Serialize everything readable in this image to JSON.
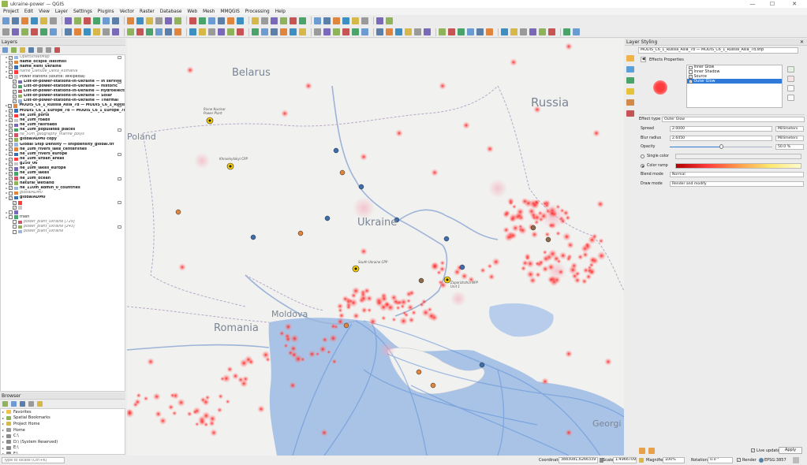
{
  "window": {
    "title": "ukraine-power — QGIS",
    "minimize": "—",
    "maximize": "☐",
    "close": "✕"
  },
  "menu": [
    "Project",
    "Edit",
    "View",
    "Layer",
    "Settings",
    "Plugins",
    "Vector",
    "Raster",
    "Database",
    "Web",
    "Mesh",
    "MMQGIS",
    "Processing",
    "Help"
  ],
  "colors": {
    "accent": "#2f7ad6",
    "heat": "#ff2020",
    "sea": "#a8c3e6",
    "shipping": "#5f8fd6"
  },
  "layers_panel": {
    "title": "Layers",
    "items": [
      {
        "label": "OpenStreetMap",
        "style": "ital",
        "indent": 1,
        "checked": true
      },
      {
        "label": "name_ocsple_lselimsli",
        "style": "bold",
        "indent": 1,
        "checked": true
      },
      {
        "label": "name_Reni_Ukraine",
        "style": "bold",
        "indent": 1,
        "checked": true
      },
      {
        "label": "name_Danube_Delta_Romania",
        "style": "ital",
        "indent": 1,
        "checked": false
      },
      {
        "label": "Power stations (source: Wikipedia)",
        "style": "normal",
        "indent": 1,
        "checked": true
      },
      {
        "label": "List-of-power-stations-in-Ukraine — In service",
        "style": "bold",
        "indent": 2,
        "checked": true
      },
      {
        "label": "List-of-power-stations-in-Ukraine — Historic",
        "style": "bold",
        "indent": 2,
        "checked": true
      },
      {
        "label": "List-of-power-stations-in-Ukraine — Hydroelectric",
        "style": "bold",
        "indent": 2,
        "checked": true
      },
      {
        "label": "List-of-power-stations-in-Ukraine — Solar",
        "style": "bold",
        "indent": 2,
        "checked": true
      },
      {
        "label": "List-of-power-stations-in-Ukraine — Thermal",
        "style": "bold",
        "indent": 2,
        "checked": true
      },
      {
        "label": "MODIS_C6_1_Russia_Asia_7d — MODIS_C6_1_Russia_Asia",
        "style": "bold",
        "indent": 1,
        "checked": true
      },
      {
        "label": "MODIS_C6_1_Europe_7d — MODIS_C6_1_Europe_7d.s",
        "style": "bold",
        "indent": 1,
        "checked": true
      },
      {
        "label": "ne_10m_ports",
        "style": "bold",
        "indent": 1,
        "checked": true
      },
      {
        "label": "ne_10m_roads",
        "style": "bold",
        "indent": 1,
        "checked": true
      },
      {
        "label": "ne_10m_railroads",
        "style": "bold",
        "indent": 1,
        "checked": true
      },
      {
        "label": "ne_10m_populated_places",
        "style": "bold",
        "indent": 1,
        "checked": true
      },
      {
        "label": "ne_50m_geography_marine_polys",
        "style": "ital",
        "indent": 1,
        "checked": false
      },
      {
        "label": "globalADM0 copy",
        "style": "bold",
        "indent": 1,
        "checked": true
      },
      {
        "label": "Global Ship Density — shipdensity_global.tif",
        "style": "bold",
        "indent": 1,
        "checked": true
      },
      {
        "label": "ne_10m_rivers_lake_centerlines",
        "style": "bold",
        "indent": 1,
        "checked": true
      },
      {
        "label": "ne_10m_rivers_europe",
        "style": "bold",
        "indent": 1,
        "checked": true
      },
      {
        "label": "ne_10m_urban_areas",
        "style": "bold",
        "indent": 1,
        "checked": true
      },
      {
        "label": "g250_06",
        "style": "bold",
        "indent": 1,
        "checked": true
      },
      {
        "label": "ne_10m_lakes_europe",
        "style": "bold",
        "indent": 1,
        "checked": true
      },
      {
        "label": "ne_10m_lakes",
        "style": "bold",
        "indent": 1,
        "checked": true
      },
      {
        "label": "ne_10m_ocean",
        "style": "bold",
        "indent": 1,
        "checked": true
      },
      {
        "label": "natural_wetland",
        "style": "bold",
        "indent": 1,
        "checked": true
      },
      {
        "label": "ne_110m_admin_0_countries",
        "style": "bold",
        "indent": 1,
        "checked": true
      },
      {
        "label": "globalADM0",
        "style": "ital",
        "indent": 1,
        "checked": false
      },
      {
        "label": "globalADM0",
        "style": "bold",
        "indent": 1,
        "checked": true
      },
      {
        "label": "",
        "style": "normal",
        "indent": 2,
        "checked": true
      },
      {
        "label": "",
        "style": "normal",
        "indent": 2,
        "checked": true
      },
      {
        "label": "",
        "style": "normal",
        "indent": 1,
        "checked": false
      },
      {
        "label": "trash",
        "style": "normal",
        "indent": 1,
        "checked": false
      },
      {
        "label": "power_plant_Ukraine [729]",
        "style": "ital",
        "indent": 2,
        "checked": false
      },
      {
        "label": "power_plant_Ukraine [243]",
        "style": "ital",
        "indent": 2,
        "checked": false
      },
      {
        "label": "power_plant_Ukraine",
        "style": "ital",
        "indent": 2,
        "checked": false
      }
    ]
  },
  "browser_panel": {
    "title": "Browser",
    "items": [
      "Favorites",
      "Spatial Bookmarks",
      "Project Home",
      "Home",
      "C:\\",
      "D:\\ (System Reserved)",
      "E:\\",
      "F:\\"
    ]
  },
  "locator": {
    "placeholder": "Type to locate (Ctrl+K)"
  },
  "map": {
    "labels": [
      {
        "text": "Belarus",
        "size": 13
      },
      {
        "text": "Russia",
        "size": 15
      },
      {
        "text": "Ukraine",
        "size": 13
      },
      {
        "text": "Poland",
        "size": 11
      },
      {
        "text": "Moldova",
        "size": 11
      },
      {
        "text": "Romania",
        "size": 13
      },
      {
        "text": "Georgi",
        "size": 11
      },
      {
        "text": "Rivne Nuclear Power Plant",
        "size": 4
      },
      {
        "text": "Khmelnytskyi CPP",
        "size": 4
      },
      {
        "text": "South Ukraine CPP",
        "size": 4
      },
      {
        "text": "Zaporizhzhia NPP Unit 1",
        "size": 4
      }
    ]
  },
  "styling_panel": {
    "title": "Layer Styling",
    "layer": "MODIS_C6_1_Russia_Asia_7d — MODIS_C6_1_Russia_Asia_7d.shp",
    "effects_title": "Effects Properties",
    "effects": [
      {
        "label": "Inner Glow",
        "checked": false,
        "selected": false
      },
      {
        "label": "Inner Shadow",
        "checked": false,
        "selected": false
      },
      {
        "label": "Source",
        "checked": true,
        "selected": false
      },
      {
        "label": "Outer Glow",
        "checked": true,
        "selected": true
      }
    ],
    "effect_type_label": "Effect type",
    "effect_type": "Outer Glow",
    "spread_label": "Spread",
    "spread": "2.0000",
    "spread_unit": "Millimeters",
    "blur_label": "Blur radius",
    "blur": "2.6450",
    "blur_unit": "Millimeters",
    "opacity_label": "Opacity",
    "opacity": "50.0 %",
    "opacity_value": 50,
    "single_color_label": "Single color",
    "color_ramp_label": "Color ramp",
    "blend_label": "Blend mode",
    "blend": "Normal",
    "draw_label": "Draw mode",
    "draw": "Render and modify",
    "live_update": "Live update",
    "apply": "Apply"
  },
  "status": {
    "coordinate_label": "Coordinate",
    "coordinate": "3883081,6266339",
    "scale_label": "Scale",
    "scale": "1:4966709",
    "magnifier_label": "Magnifier",
    "magnifier": "100%",
    "rotation_label": "Rotation",
    "rotation": "0.0 °",
    "render_label": "Render",
    "crs": "EPSG:3857"
  }
}
